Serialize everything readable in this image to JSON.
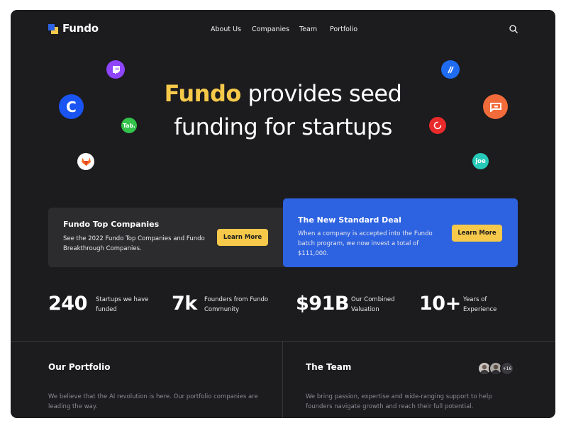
{
  "brand": {
    "name": "Fundo",
    "colors": {
      "blue": "#2f62e3",
      "yellow": "#f6c94a"
    }
  },
  "nav": {
    "items": [
      {
        "label": "About Us"
      },
      {
        "label": "Companies"
      },
      {
        "label": "Team"
      },
      {
        "label": "Portfolio"
      }
    ],
    "search_icon": "search-icon"
  },
  "hero": {
    "accent": "Fundo",
    "line1_rest": " provides seed",
    "line2": "funding for startups"
  },
  "logo_bubbles": [
    {
      "name": "twitch-logo-icon"
    },
    {
      "name": "coinbase-logo-icon",
      "letter": "C"
    },
    {
      "name": "tab-logo-icon",
      "text": "Tab."
    },
    {
      "name": "gitlab-logo-icon"
    },
    {
      "name": "slash-logo-icon"
    },
    {
      "name": "flag-logo-icon"
    },
    {
      "name": "red-circle-logo-icon"
    },
    {
      "name": "joe-logo-icon",
      "text": "joe"
    }
  ],
  "cards": {
    "top_companies": {
      "title": "Fundo Top Companies",
      "text": "See the 2022 Fundo Top Companies and Fundo Breakthrough Companies.",
      "button": "Learn More",
      "background": "#2c2c2f"
    },
    "standard_deal": {
      "title": "The New Standard Deal",
      "text": "When a company is accepted into the Fundo batch program, we now invest a total of $111,000.",
      "button": "Learn More",
      "background": "#2d62e0"
    }
  },
  "stats": [
    {
      "value": "240",
      "label": "Startups we have funded"
    },
    {
      "value": "7k",
      "label": "Founders from Fundo Community"
    },
    {
      "value": "$91B",
      "label": "Our Combined Valuation"
    },
    {
      "value": "10+",
      "label": "Years of Experience"
    }
  ],
  "portfolio": {
    "title": "Our Portfolio",
    "text": "We believe that the AI revolution is here. Our portfolio companies are leading the way."
  },
  "team": {
    "title": "The Team",
    "text": "We bring passion, expertise and wide-ranging support to help founders navigate growth and reach their full potential.",
    "more_count": "+16"
  }
}
